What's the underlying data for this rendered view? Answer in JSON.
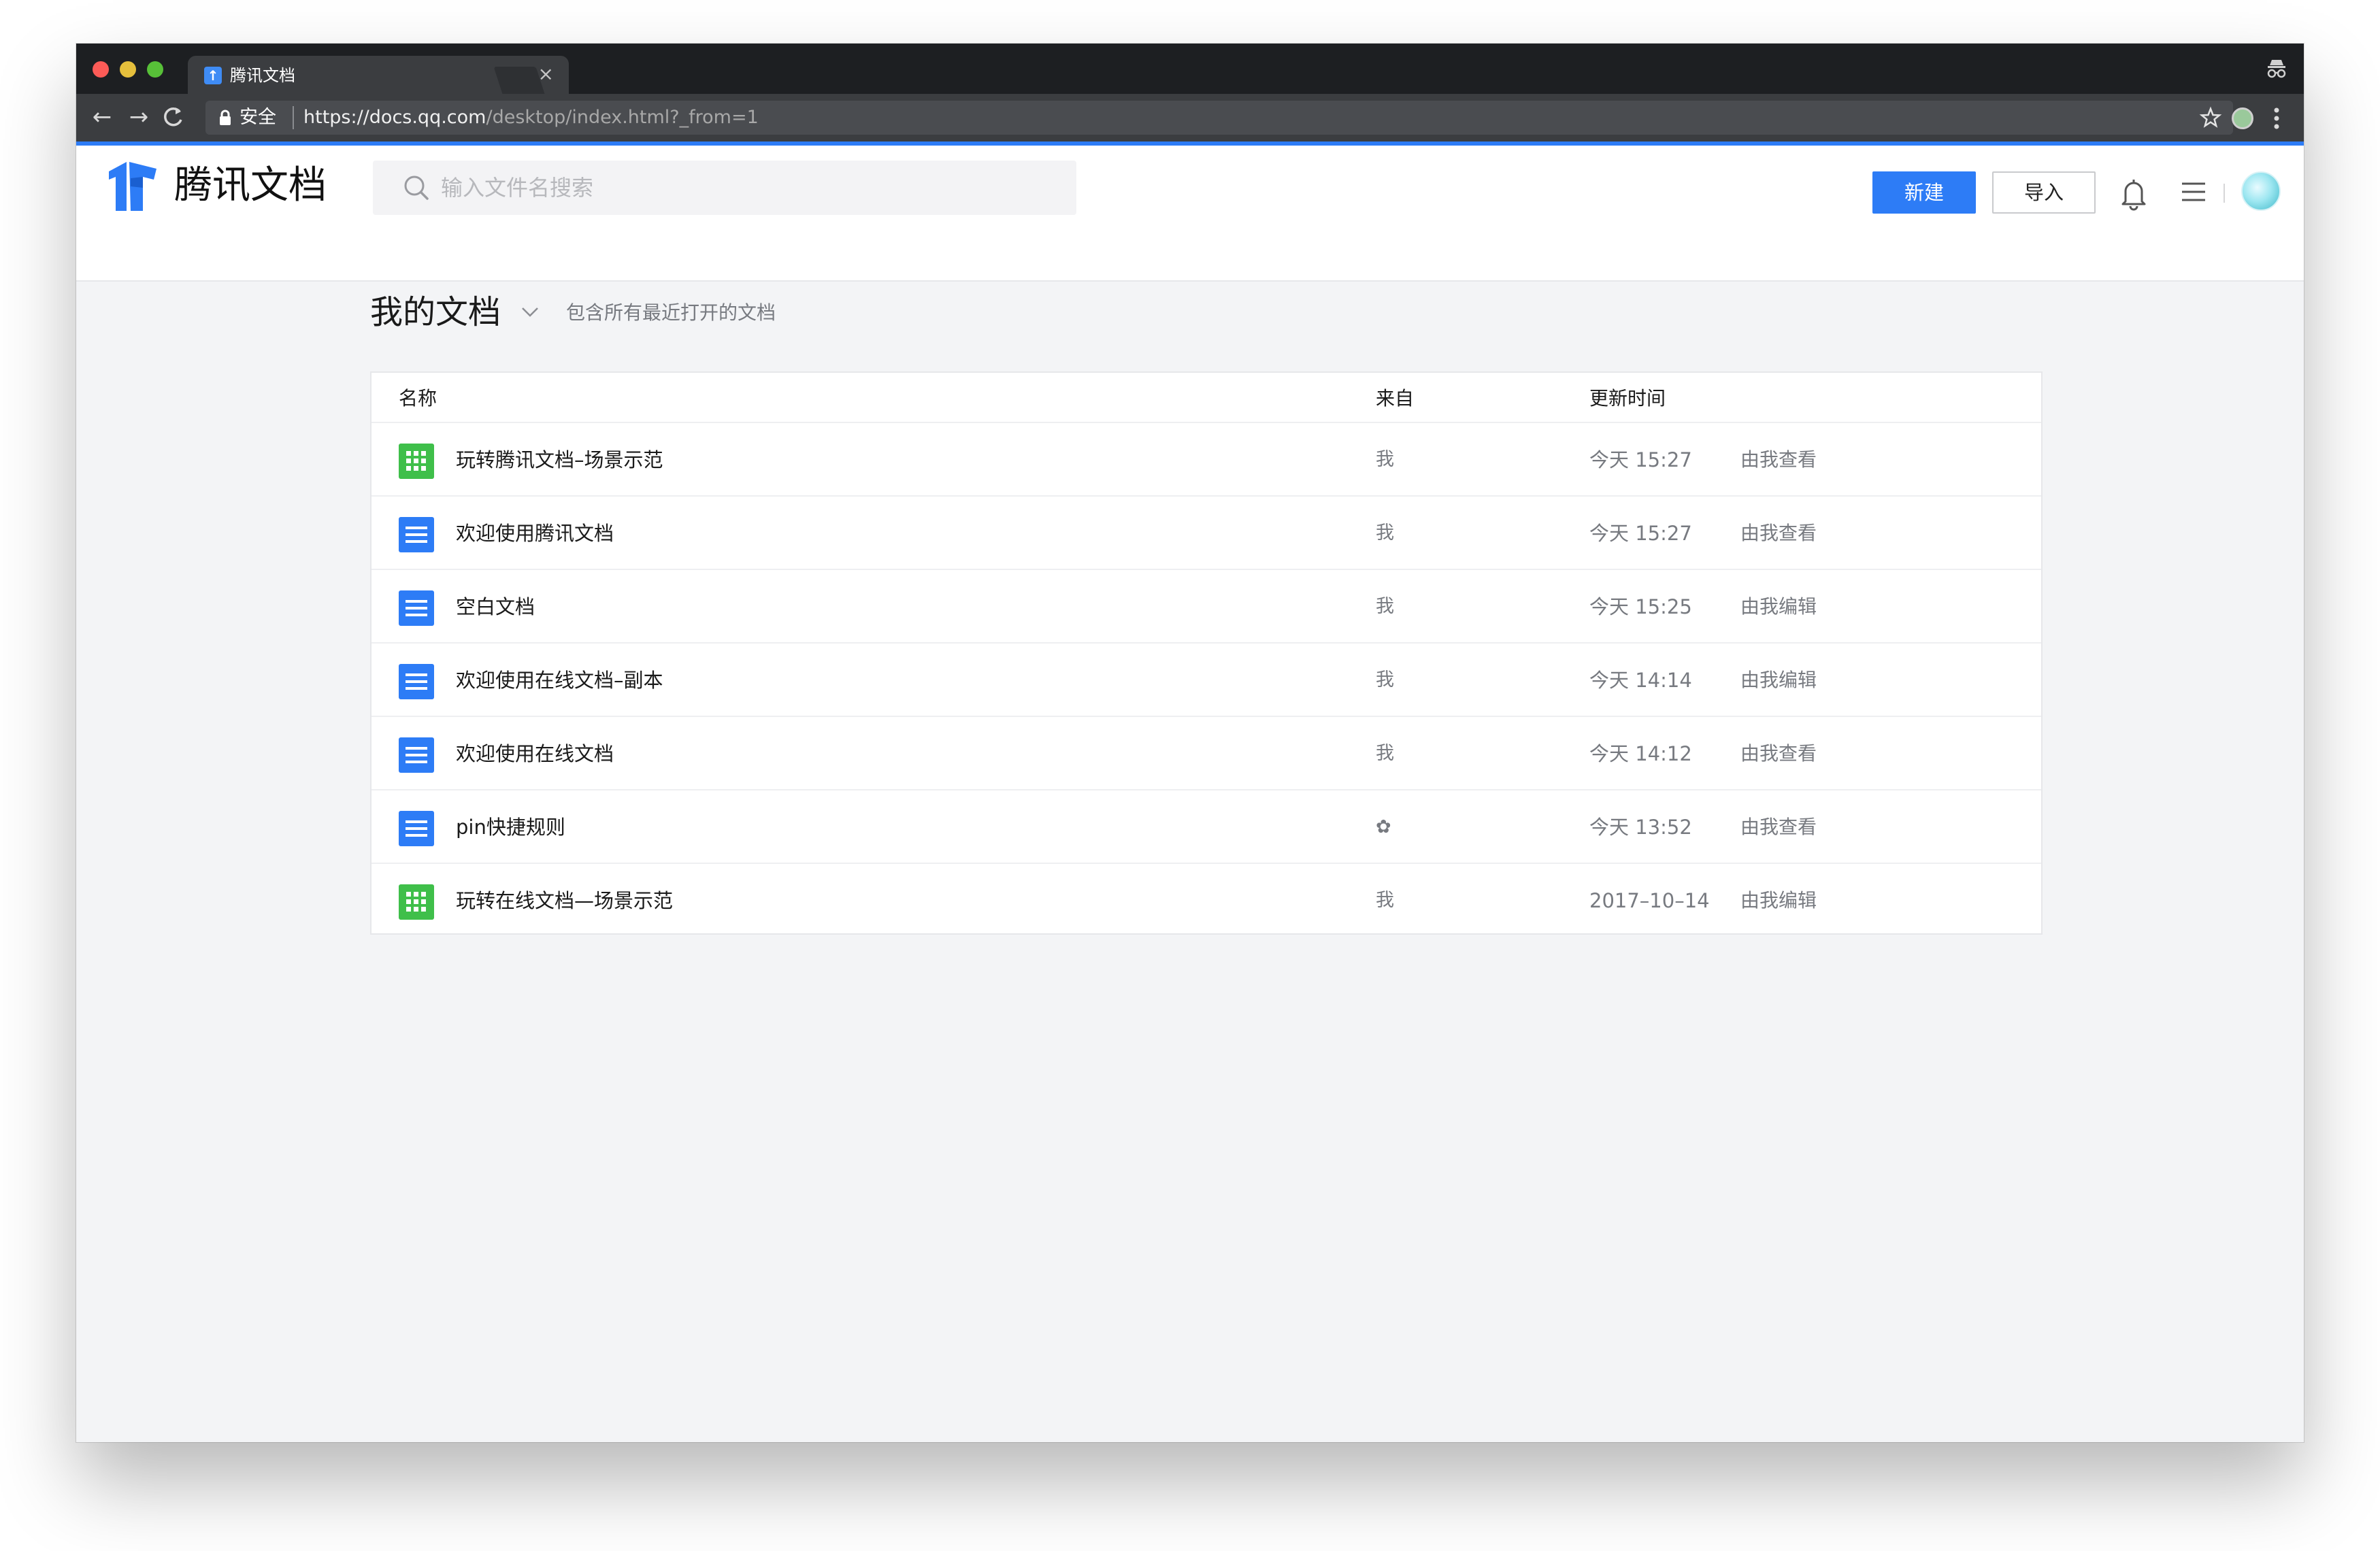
{
  "browser": {
    "tab_title": "腾讯文档",
    "tab_close": "×",
    "secure_label": "安全",
    "url_host": "https://docs.qq.com",
    "url_path": "/desktop/index.html?_from=1"
  },
  "header": {
    "logo_text": "腾讯文档",
    "search_placeholder": "输入文件名搜索",
    "new_button": "新建",
    "import_button": "导入"
  },
  "page": {
    "title": "我的文档",
    "subtitle": "包含所有最近打开的文档"
  },
  "table": {
    "headers": {
      "name": "名称",
      "from": "来自",
      "time": "更新时间"
    },
    "rows": [
      {
        "type": "sheet",
        "name": "玩转腾讯文档–场景示范",
        "from": "我",
        "time": "今天 15:27",
        "action": "由我查看"
      },
      {
        "type": "doc",
        "name": "欢迎使用腾讯文档",
        "from": "我",
        "time": "今天 15:27",
        "action": "由我查看"
      },
      {
        "type": "doc",
        "name": "空白文档",
        "from": "我",
        "time": "今天 15:25",
        "action": "由我编辑"
      },
      {
        "type": "doc",
        "name": "欢迎使用在线文档–副本",
        "from": "我",
        "time": "今天 14:14",
        "action": "由我编辑"
      },
      {
        "type": "doc",
        "name": "欢迎使用在线文档",
        "from": "我",
        "time": "今天 14:12",
        "action": "由我查看"
      },
      {
        "type": "doc",
        "name": "pin快捷规则",
        "from": "✿",
        "time": "今天 13:52",
        "action": "由我查看"
      },
      {
        "type": "sheet",
        "name": "玩转在线文档—场景示范",
        "from": "我",
        "time": "2017–10–14",
        "action": "由我编辑"
      }
    ]
  },
  "colors": {
    "accent": "#2d7cf6",
    "sheet_icon": "#3fbf4a",
    "background": "#f3f4f6"
  }
}
